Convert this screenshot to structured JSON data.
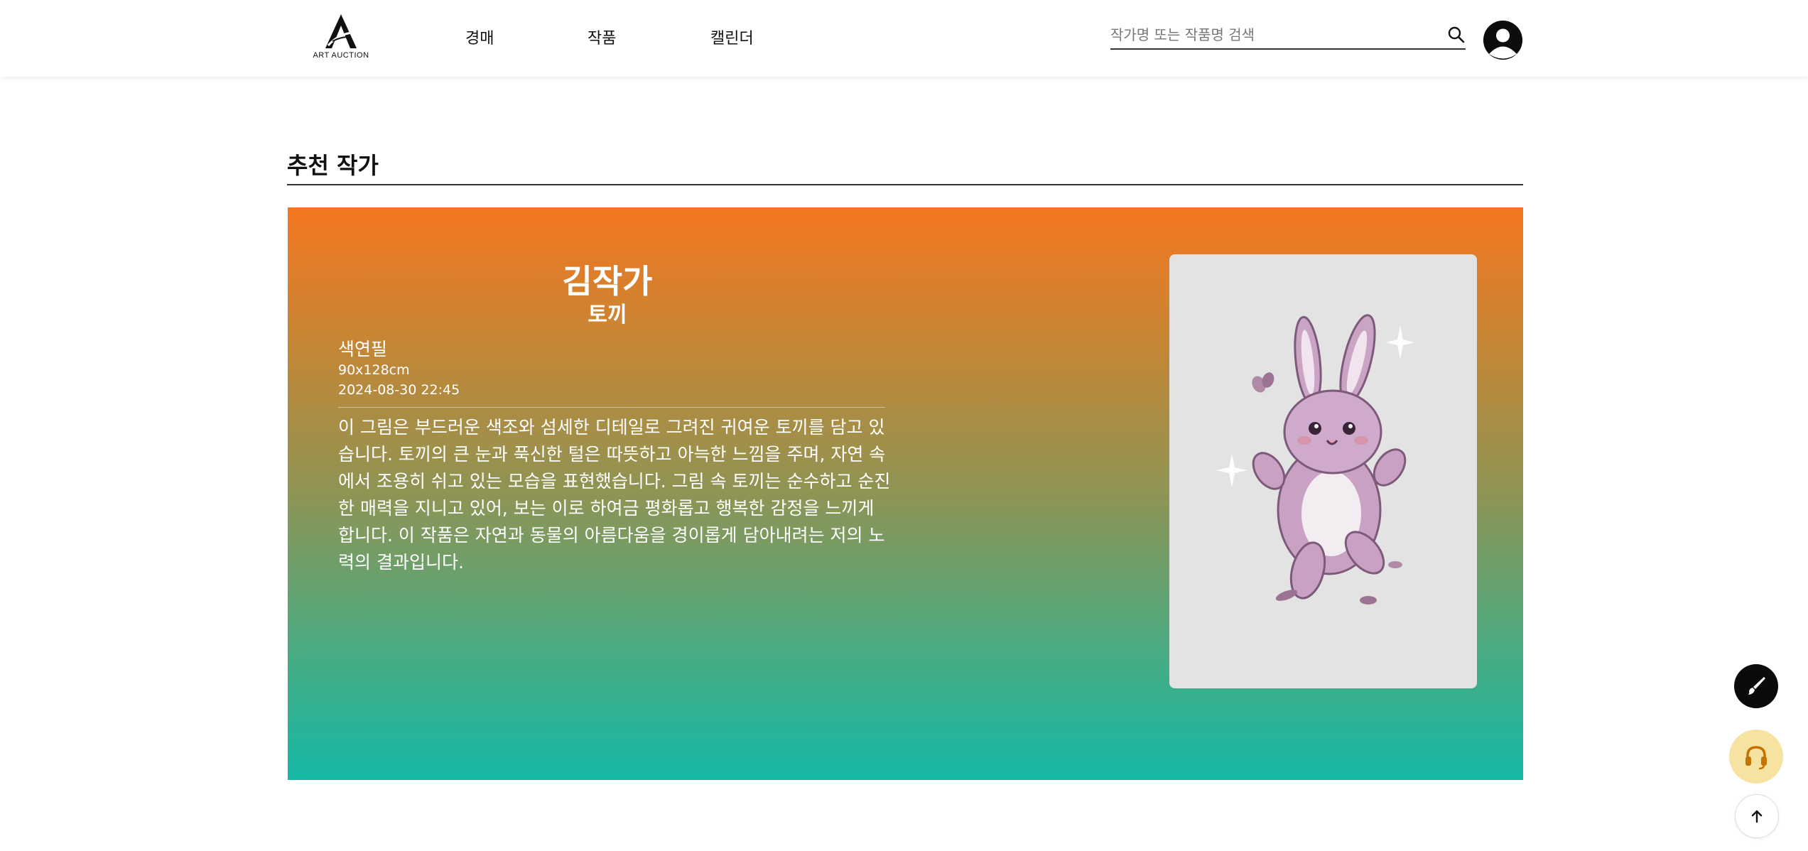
{
  "header": {
    "logo_text": "ART AUCTION",
    "nav": {
      "auction": "경매",
      "works": "작품",
      "calendar": "캘린더"
    },
    "search": {
      "placeholder": "작가명 또는 작품명 검색",
      "value": ""
    }
  },
  "section": {
    "title": "추천 작가"
  },
  "featured": {
    "artist_name": "김작가",
    "artwork_title": "토끼",
    "medium": "색연필",
    "size": "90x128cm",
    "date": "2024-08-30 22:45",
    "description": "이 그림은 부드러운 색조와 섬세한 디테일로 그려진 귀여운 토끼를 담고 있습니다. 토끼의 큰 눈과 푹신한 털은 따뜻하고 아늑한 느낌을 주며, 자연 속에서 조용히 쉬고 있는 모습을 표현했습니다. 그림 속 토끼는 순수하고 순진한 매력을 지니고 있어, 보는 이로 하여금 평화롭고 행복한 감정을 느끼게 합니다. 이 작품은 자연과 동물의 아름다움을 경이롭게 담아내려는 저의 노력의 결과입니다."
  },
  "colors": {
    "gradient_top": "#f47620",
    "gradient_bottom": "#15b8a6",
    "art_background": "#e3e3e3",
    "support_button": "#f6e2a1",
    "dark": "#0b0b0b"
  },
  "icons": {
    "logo": "logo-a-icon",
    "search": "search-icon",
    "avatar": "user-avatar-icon",
    "brush": "paint-brush-icon",
    "support": "headset-icon",
    "top": "arrow-up-icon"
  }
}
